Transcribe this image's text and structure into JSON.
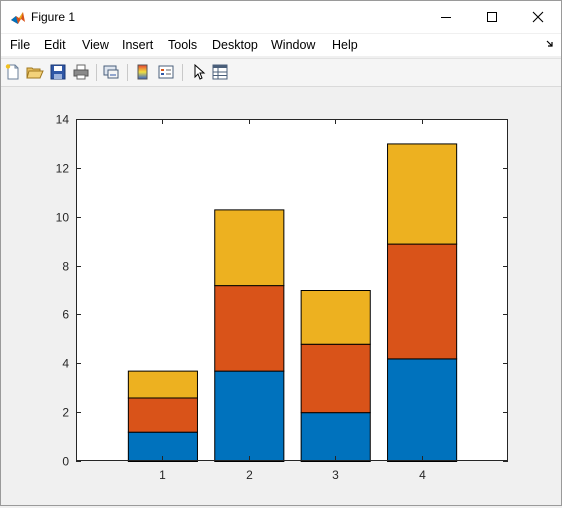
{
  "window": {
    "title": "Figure 1",
    "minimize_icon": "minimize-icon",
    "maximize_icon": "maximize-icon",
    "close_icon": "close-icon"
  },
  "menubar": {
    "items": [
      {
        "label": "File"
      },
      {
        "label": "Edit"
      },
      {
        "label": "View"
      },
      {
        "label": "Insert"
      },
      {
        "label": "Tools"
      },
      {
        "label": "Desktop"
      },
      {
        "label": "Window"
      },
      {
        "label": "Help"
      }
    ]
  },
  "toolbar": {
    "buttons": [
      {
        "icon": "new-figure-icon"
      },
      {
        "icon": "open-file-icon"
      },
      {
        "icon": "save-icon"
      },
      {
        "icon": "print-icon"
      },
      {
        "icon": "link-plot-icon"
      },
      {
        "icon": "colorbar-icon"
      },
      {
        "icon": "legend-icon"
      },
      {
        "icon": "edit-plot-pointer-icon"
      },
      {
        "icon": "property-inspector-icon"
      }
    ]
  },
  "colors": {
    "series1": "#0072BD",
    "series2": "#D95319",
    "series3": "#EDB120"
  },
  "chart_data": {
    "type": "bar",
    "stacked": true,
    "categories": [
      "1",
      "2",
      "3",
      "4"
    ],
    "series": [
      {
        "values": [
          1.2,
          3.7,
          2.0,
          4.2
        ],
        "color": "#0072BD"
      },
      {
        "values": [
          1.4,
          3.5,
          2.8,
          4.7
        ],
        "color": "#D95319"
      },
      {
        "values": [
          1.1,
          3.1,
          2.2,
          4.1
        ],
        "color": "#EDB120"
      }
    ],
    "xlim": [
      0,
      5
    ],
    "ylim": [
      0,
      14
    ],
    "yticks": [
      "0",
      "2",
      "4",
      "6",
      "8",
      "10",
      "12",
      "14"
    ],
    "grid": false,
    "legend": false
  }
}
